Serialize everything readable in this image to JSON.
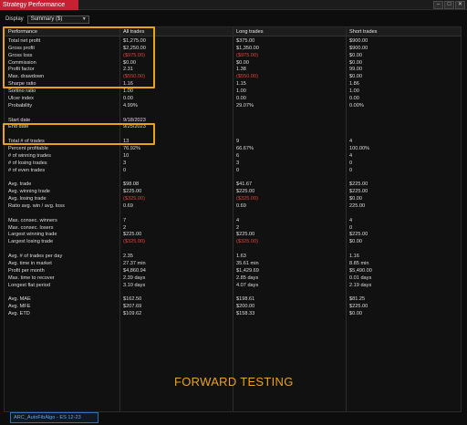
{
  "window": {
    "title": "Strategy Performance",
    "buttons": [
      "–",
      "□",
      "✕"
    ]
  },
  "display": {
    "label": "Display",
    "selected": "Summary ($)"
  },
  "table": {
    "headers": [
      "Performance",
      "All trades",
      "Long trades",
      "Short trades"
    ],
    "rows": [
      {
        "label": "Total net profit",
        "all": "$1,275.00",
        "long": "$375.00",
        "short": "$900.00"
      },
      {
        "label": "Gross profit",
        "all": "$2,250.00",
        "long": "$1,350.00",
        "short": "$900.00"
      },
      {
        "label": "Gross loss",
        "all": "($975.00)",
        "long": "($975.00)",
        "short": "$0.00"
      },
      {
        "label": "Commission",
        "all": "$0.00",
        "long": "$0.00",
        "short": "$0.00"
      },
      {
        "label": "Profit factor",
        "all": "2.31",
        "long": "1.38",
        "short": "99.00"
      },
      {
        "label": "Max. drawdown",
        "all": "($550.00)",
        "long": "($550.00)",
        "short": "$0.00"
      },
      {
        "label": "Sharpe ratio",
        "all": "1.16",
        "long": "1.15",
        "short": "1.86"
      },
      {
        "label": "Sortino ratio",
        "all": "1.00",
        "long": "1.00",
        "short": "1.00"
      },
      {
        "label": "Ulcer index",
        "all": "0.00",
        "long": "0.00",
        "short": "0.00"
      },
      {
        "label": "Probability",
        "all": "4.99%",
        "long": "29.07%",
        "short": "0.00%"
      },
      {
        "label": "",
        "all": "",
        "long": "",
        "short": ""
      },
      {
        "label": "Start date",
        "all": "9/18/2023",
        "long": "",
        "short": ""
      },
      {
        "label": "End date",
        "all": "9/25/2023",
        "long": "",
        "short": ""
      },
      {
        "label": "",
        "all": "",
        "long": "",
        "short": ""
      },
      {
        "label": "Total # of trades",
        "all": "13",
        "long": "9",
        "short": "4"
      },
      {
        "label": "Percent profitable",
        "all": "76.92%",
        "long": "66.67%",
        "short": "100.00%"
      },
      {
        "label": "# of winning trades",
        "all": "10",
        "long": "6",
        "short": "4"
      },
      {
        "label": "# of losing trades",
        "all": "3",
        "long": "3",
        "short": "0"
      },
      {
        "label": "# of even trades",
        "all": "0",
        "long": "0",
        "short": "0"
      },
      {
        "label": "",
        "all": "",
        "long": "",
        "short": ""
      },
      {
        "label": "Avg. trade",
        "all": "$98.08",
        "long": "$41.67",
        "short": "$225.00"
      },
      {
        "label": "Avg. winning trade",
        "all": "$225.00",
        "long": "$225.00",
        "short": "$225.00"
      },
      {
        "label": "Avg. losing trade",
        "all": "($325.00)",
        "long": "($325.00)",
        "short": "$0.00"
      },
      {
        "label": "Ratio avg. win / avg. loss",
        "all": "0.69",
        "long": "0.69",
        "short": "225.00"
      },
      {
        "label": "",
        "all": "",
        "long": "",
        "short": ""
      },
      {
        "label": "Max. consec. winners",
        "all": "7",
        "long": "4",
        "short": "4"
      },
      {
        "label": "Max. consec. losers",
        "all": "2",
        "long": "2",
        "short": "0"
      },
      {
        "label": "Largest winning trade",
        "all": "$225.00",
        "long": "$225.00",
        "short": "$225.00"
      },
      {
        "label": "Largest losing trade",
        "all": "($325.00)",
        "long": "($325.00)",
        "short": "$0.00"
      },
      {
        "label": "",
        "all": "",
        "long": "",
        "short": ""
      },
      {
        "label": "Avg. # of trades per day",
        "all": "2.35",
        "long": "1.63",
        "short": "1.16"
      },
      {
        "label": "Avg. time in market",
        "all": "27.37 min",
        "long": "35.61 min",
        "short": "8.85 min"
      },
      {
        "label": "Profit per month",
        "all": "$4,860.94",
        "long": "$1,429.69",
        "short": "$5,490.00"
      },
      {
        "label": "Max. time to recover",
        "all": "2.39 days",
        "long": "2.85 days",
        "short": "0.01 days"
      },
      {
        "label": "Longest flat period",
        "all": "3.10 days",
        "long": "4.07 days",
        "short": "2.19 days"
      },
      {
        "label": "",
        "all": "",
        "long": "",
        "short": ""
      },
      {
        "label": "Avg. MAE",
        "all": "$162.50",
        "long": "$198.61",
        "short": "$81.25"
      },
      {
        "label": "Avg. MFE",
        "all": "$207.69",
        "long": "$200.00",
        "short": "$225.00"
      },
      {
        "label": "Avg. ETD",
        "all": "$109.62",
        "long": "$158.33",
        "short": "$0.00"
      }
    ]
  },
  "watermark": "FORWARD TESTING",
  "bottom_tab": "ARC_AutoFibAlgo - ES 12-23",
  "colors": {
    "negative": "#e2413b",
    "highlight": "#e8a317",
    "title_tab": "#c62033",
    "bottom_tab_border": "#2f6fb5"
  }
}
